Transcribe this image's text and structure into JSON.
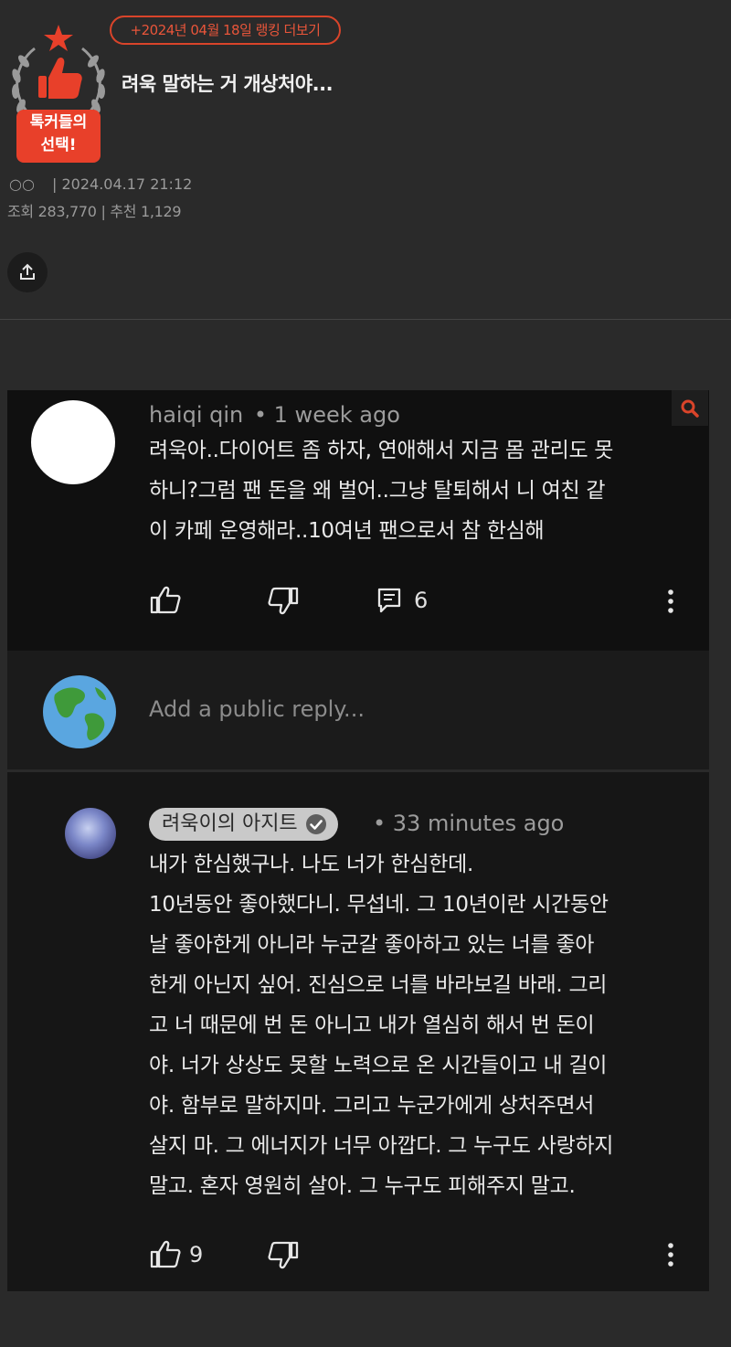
{
  "post": {
    "badge_line1": "톡커들의",
    "badge_line2": "선택!",
    "rank_link": "+2024년 04월 18일 랭킹 더보기",
    "title": "려욱 말하는 거 개상처야...",
    "author": "○○",
    "datetime": "| 2024.04.17 21:12",
    "stats": "조회 283,770 | 추천 1,129",
    "share_icon": "share-icon"
  },
  "comment1": {
    "author": "haiqi qin",
    "time": "• 1 week ago",
    "lines": [
      "려욱아..다이어트 좀 하자, 연애해서 지금 몸 관리도 못",
      "하니?그럼 팬 돈을 왜 벌어..그냥 탈퇴해서 니 여친 같",
      "이 카페 운영해라..10여년 팬으로서 참 한심해"
    ],
    "reply_count": "6"
  },
  "reply_box": {
    "placeholder": "Add a public reply..."
  },
  "comment2": {
    "author": "려욱이의 아지트",
    "time": "• 33 minutes ago",
    "lines": [
      "내가 한심했구나. 나도 너가 한심한데.",
      "10년동안 좋아했다니. 무섭네. 그 10년이란 시간동안",
      "날 좋아한게 아니라 누군갈 좋아하고 있는 너를 좋아",
      "한게 아닌지 싶어. 진심으로 너를 바라보길 바래. 그리",
      "고 너 때문에 번 돈 아니고 내가 열심히 해서 번 돈이",
      "야. 너가 상상도 못할 노력으로 온 시간들이고 내 길이",
      "야. 함부로 말하지마. 그리고 누군가에게 상처주면서",
      "살지 마. 그 에너지가 너무 아깝다. 그 누구도 사랑하지",
      "말고. 혼자 영원히 살아. 그 누구도 피해주지 말고."
    ],
    "like_count": "9"
  },
  "colors": {
    "accent": "#e8553a",
    "background": "#2a2a2a",
    "comment_bg": "#101010"
  }
}
